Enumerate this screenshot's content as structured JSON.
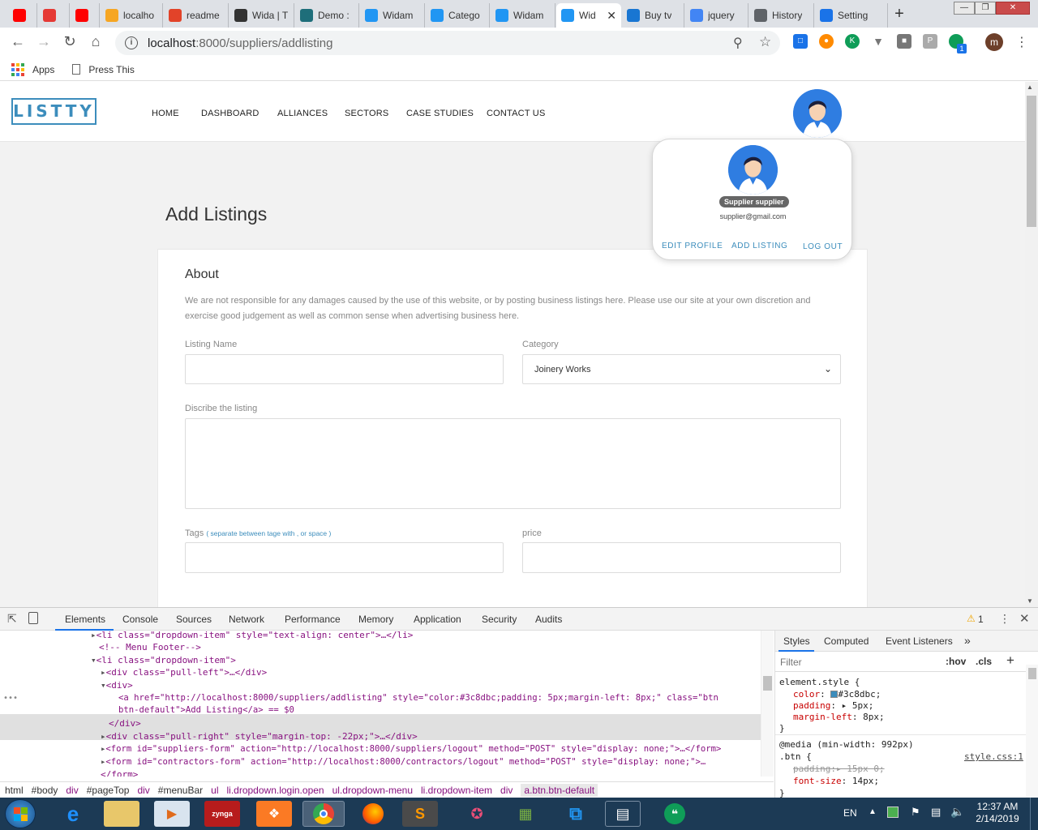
{
  "browser": {
    "tabs": [
      {
        "title": "",
        "icon": "youtube-icon",
        "color": "#ff0000"
      },
      {
        "title": "",
        "icon": "u-icon",
        "color": "#e53935"
      },
      {
        "title": "",
        "icon": "youtube-icon",
        "color": "#ff0000"
      },
      {
        "title": "localho",
        "icon": "phpmyadmin-icon",
        "color": "#f6a623"
      },
      {
        "title": "readme",
        "icon": "gitlab-icon",
        "color": "#e24329"
      },
      {
        "title": "Wida | T",
        "icon": "trello-icon",
        "color": "#333333"
      },
      {
        "title": "Demo :",
        "icon": "mail-icon",
        "color": "#1e6e7a"
      },
      {
        "title": "Widam",
        "icon": "l-icon",
        "color": "#2196f3"
      },
      {
        "title": "Catego",
        "icon": "l-icon",
        "color": "#2196f3"
      },
      {
        "title": "Widam",
        "icon": "l-icon",
        "color": "#2196f3"
      },
      {
        "title": "Wid",
        "icon": "l-icon",
        "color": "#2196f3",
        "active": true
      },
      {
        "title": "Buy tv",
        "icon": "store-icon",
        "color": "#1976d2"
      },
      {
        "title": "jquery",
        "icon": "google-icon",
        "color": "#4285f4"
      },
      {
        "title": "History",
        "icon": "history-icon",
        "color": "#5f6368"
      },
      {
        "title": "Setting",
        "icon": "gear-icon",
        "color": "#1a73e8"
      }
    ],
    "url_host": "localhost",
    "url_path": ":8000/suppliers/addlisting",
    "bookmarks": [
      {
        "label": "Apps"
      },
      {
        "label": "Press This"
      }
    ],
    "profile_initial": "m",
    "ext_badge": "1"
  },
  "site": {
    "logo": "LISTTY",
    "nav": [
      "HOME",
      "DASHBOARD",
      "ALLIANCES",
      "SECTORS",
      "CASE STUDIES",
      "CONTACT US"
    ],
    "page_title": "Add Listings",
    "accent_color": "#3c8dbc",
    "dropdown": {
      "name": "Supplier supplier",
      "email": "supplier@gmail.com",
      "edit_profile": "EDIT PROFILE",
      "add_listing": "ADD LISTING",
      "logout": "LOG OUT"
    },
    "form": {
      "section_title": "About",
      "disclaimer": "We are not responsible for any damages caused by the use of this website, or by posting business listings here. Please use our site at your own discretion and exercise good judgement as well as common sense when advertising business here.",
      "listing_name_label": "Listing Name",
      "listing_name_value": "",
      "category_label": "Category",
      "category_value": "Joinery Works",
      "describe_label": "Discribe the listing",
      "describe_value": "",
      "tags_label": "Tags",
      "tags_hint": "( separate between tage with , or space )",
      "tags_value": "",
      "price_label": "price",
      "price_value": ""
    }
  },
  "devtools": {
    "tabs": [
      "Elements",
      "Console",
      "Sources",
      "Network",
      "Performance",
      "Memory",
      "Application",
      "Security",
      "Audits"
    ],
    "warning_count": "1",
    "dom_lines": [
      "<li class=\"dropdown-item\" style=\"text-align: center\">…</li>",
      "<!-- Menu Footer-->",
      "<li class=\"dropdown-item\">",
      "<div class=\"pull-left\">…</div>",
      "<div>",
      "<a href=\"http://localhost:8000/suppliers/addlisting\" style=\"color:#3c8dbc;padding: 5px;margin-left: 8px;\" class=\"btn",
      "btn-default\">Add Listing</a> == $0",
      "</div>",
      "<div class=\"pull-right\" style=\"margin-top: -22px;\">…</div>",
      "<form id=\"suppliers-form\" action=\"http://localhost:8000/suppliers/logout\" method=\"POST\" style=\"display: none;\">…</form>",
      "<form id=\"contractors-form\" action=\"http://localhost:8000/contractors/logout\" method=\"POST\" style=\"display: none;\">…",
      "</form>"
    ],
    "breadcrumbs": [
      "html",
      "#body",
      "div",
      "#pageTop",
      "div",
      "#menuBar",
      "ul",
      "li.dropdown.login.open",
      "ul.dropdown-menu",
      "li.dropdown-item",
      "div",
      "a.btn.btn-default"
    ],
    "styles_tabs": [
      "Styles",
      "Computed",
      "Event Listeners"
    ],
    "filter_placeholder": "Filter",
    "hov": ":hov",
    "cls": ".cls",
    "style_rules": [
      "element.style {",
      "color: #3c8dbc;",
      "padding: ▸ 5px;",
      "margin-left: 8px;",
      "}",
      "@media (min-width: 992px)",
      ".btn {",
      "style.css:1",
      "padding:▸ 15px 0;",
      "font-size: 14px;",
      "}"
    ]
  },
  "taskbar": {
    "language": "EN",
    "time": "12:37 AM",
    "date": "2/14/2019"
  }
}
